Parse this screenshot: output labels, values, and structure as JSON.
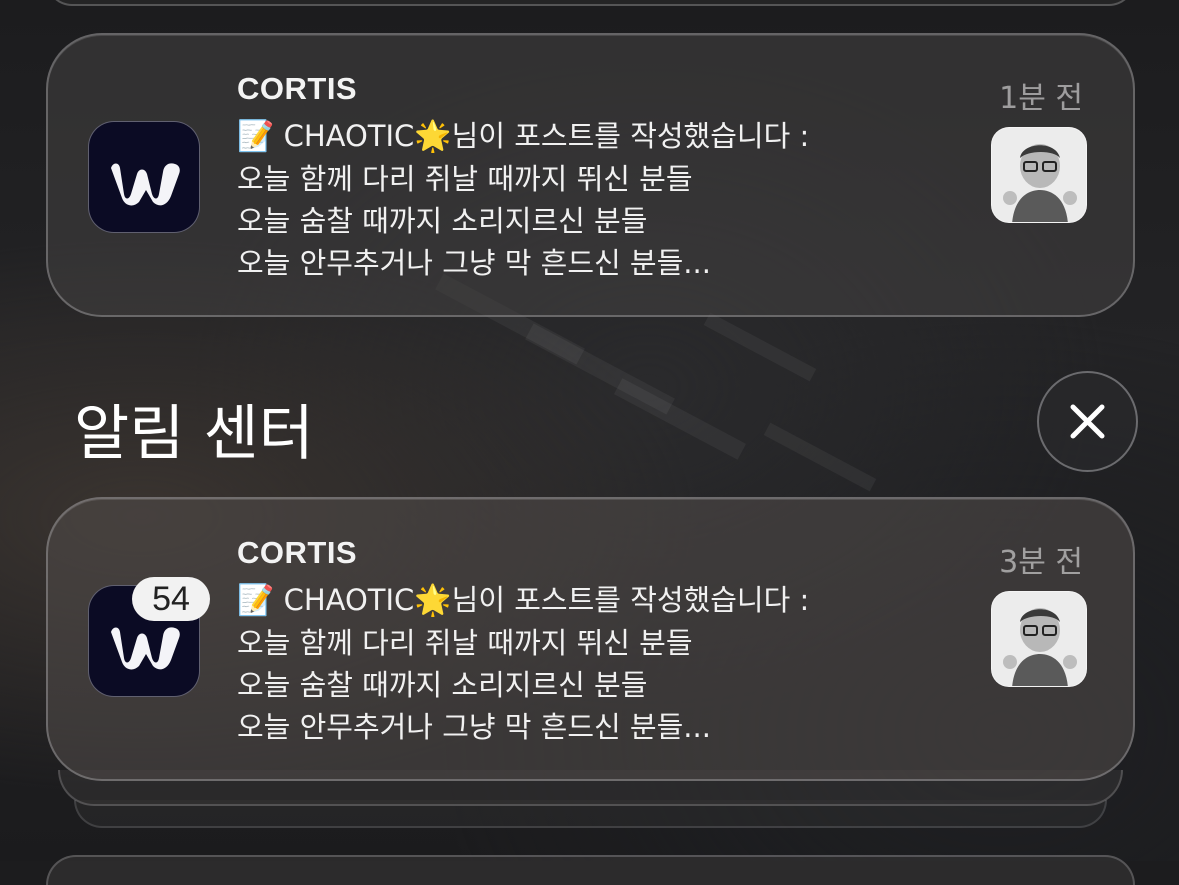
{
  "section": {
    "title": "알림 센터",
    "close_icon": "close-icon"
  },
  "notifications": [
    {
      "app": "CORTIS",
      "time": "1분 전",
      "app_icon": "weverse-app-icon",
      "badge": null,
      "lines": [
        "CHAOTIC",
        "님이 포스트를 작성했습니다 :",
        "오늘 함께 다리 쥐날 때까지 뛰신 분들",
        "오늘 숨찰 때까지 소리지르신 분들",
        "오늘 안무추거나 그냥 막 흔드신 분들..."
      ],
      "emojis": [
        "📝",
        "🌟"
      ]
    },
    {
      "app": "CORTIS",
      "time": "3분 전",
      "app_icon": "weverse-app-icon",
      "badge": "54",
      "lines": [
        "CHAOTIC",
        "님이 포스트를 작성했습니다 :",
        "오늘 함께 다리 쥐날 때까지 뛰신 분들",
        "오늘 숨찰 때까지 소리지르신 분들",
        "오늘 안무추거나 그냥 막 흔드신 분들..."
      ],
      "emojis": [
        "📝",
        "🌟"
      ]
    }
  ]
}
